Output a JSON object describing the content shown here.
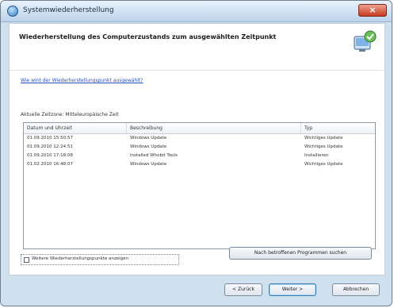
{
  "window": {
    "title": "Systemwiederherstellung"
  },
  "header": {
    "title": "Wiederherstellung des Computerzustands zum ausgewählten Zeitpunkt"
  },
  "link": {
    "text": "Wie wird der Wiederherstellungspunkt ausgewählt?"
  },
  "timezone": {
    "text": "Aktuelle Zeitzone: Mitteleuropäische Zeit"
  },
  "table": {
    "headers": [
      "Datum und Uhrzeit",
      "Beschreibung",
      "Typ"
    ],
    "rows": [
      [
        "01.09.2010 15:50:57",
        "Windows Update",
        "Wichtiges Update"
      ],
      [
        "01.09.2010 12:24:51",
        "Windows Update",
        "Wichtiges Update"
      ],
      [
        "01.09.2010 17:18:08",
        "Installed Whobit Tools",
        "Installieren"
      ],
      [
        "01.02.2010 16:48:07",
        "Windows Update",
        "Wichtiges Update"
      ]
    ]
  },
  "options": {
    "show_more_label": "Weitere Wiederherstellungspunkte anzeigen",
    "scan_label": "Nach betroffenen Programmen suchen"
  },
  "buttons": {
    "back": "< Zurück",
    "next": "Weiter >",
    "cancel": "Abbrechen"
  }
}
